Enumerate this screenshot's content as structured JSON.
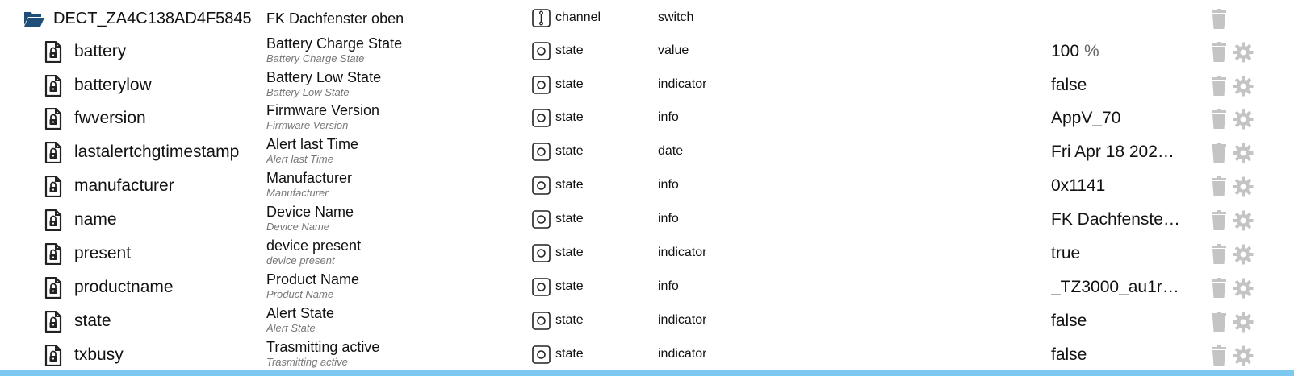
{
  "channel": {
    "id": "DECT_ZA4C138AD4F5845",
    "name": "FK Dachfenster oben",
    "type": "channel",
    "role": "switch",
    "icon": "folder-open-icon"
  },
  "states": [
    {
      "id": "battery",
      "name": "Battery Charge State",
      "desc": "Battery Charge State",
      "type": "state",
      "role": "value",
      "value": "100",
      "unit": "%"
    },
    {
      "id": "batterylow",
      "name": "Battery Low State",
      "desc": "Battery Low State",
      "type": "state",
      "role": "indicator",
      "value": "false",
      "unit": ""
    },
    {
      "id": "fwversion",
      "name": "Firmware Version",
      "desc": "Firmware Version",
      "type": "state",
      "role": "info",
      "value": "AppV_70",
      "unit": ""
    },
    {
      "id": "lastalertchgtimestamp",
      "name": "Alert last Time",
      "desc": "Alert last Time",
      "type": "state",
      "role": "date",
      "value": "Fri Apr 18 202…",
      "unit": ""
    },
    {
      "id": "manufacturer",
      "name": "Manufacturer",
      "desc": "Manufacturer",
      "type": "state",
      "role": "info",
      "value": "0x1141",
      "unit": ""
    },
    {
      "id": "name",
      "name": "Device Name",
      "desc": "Device Name",
      "type": "state",
      "role": "info",
      "value": "FK Dachfenste…",
      "unit": ""
    },
    {
      "id": "present",
      "name": "device present",
      "desc": "device present",
      "type": "state",
      "role": "indicator",
      "value": "true",
      "unit": ""
    },
    {
      "id": "productname",
      "name": "Product Name",
      "desc": "Product Name",
      "type": "state",
      "role": "info",
      "value": "_TZ3000_au1r…",
      "unit": ""
    },
    {
      "id": "state",
      "name": "Alert State",
      "desc": "Alert State",
      "type": "state",
      "role": "indicator",
      "value": "false",
      "unit": ""
    },
    {
      "id": "txbusy",
      "name": "Trasmitting active",
      "desc": "Trasmitting active",
      "type": "state",
      "role": "indicator",
      "value": "false",
      "unit": ""
    }
  ],
  "colors": {
    "folder": "#1f4e79",
    "action_icons": "#c4c4c4",
    "selection_bar": "#7cc8f0"
  }
}
